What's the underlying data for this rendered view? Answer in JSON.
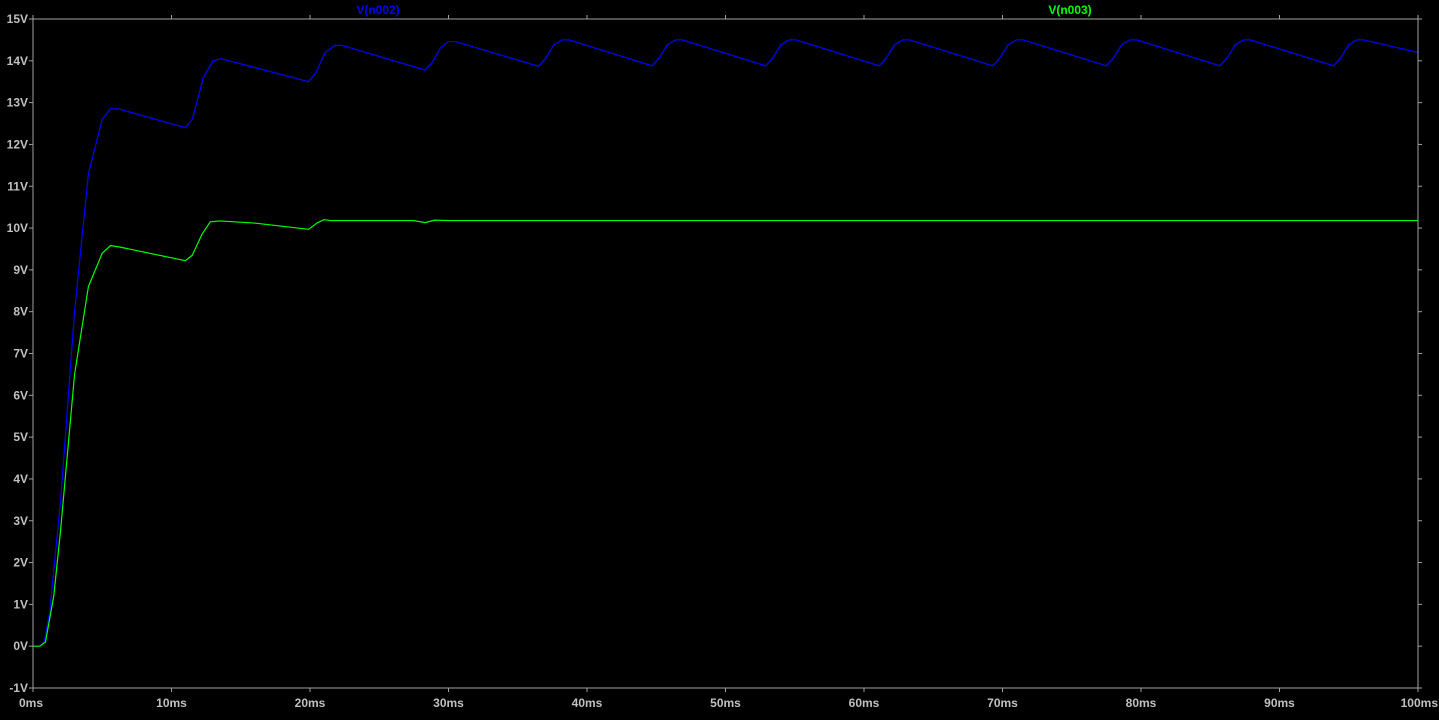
{
  "colors": {
    "background": "#000000",
    "frame": "#a0a0a0",
    "tick_text": "#c0c0c0"
  },
  "chart_data": {
    "type": "line",
    "title": "",
    "xlabel": "",
    "ylabel": "",
    "x_unit": "ms",
    "y_unit": "V",
    "xlim": [
      0,
      100
    ],
    "ylim": [
      -1,
      15
    ],
    "grid": false,
    "x_ticks": [
      0,
      10,
      20,
      30,
      40,
      50,
      60,
      70,
      80,
      90,
      100
    ],
    "y_ticks": [
      -1,
      0,
      1,
      2,
      3,
      4,
      5,
      6,
      7,
      8,
      9,
      10,
      11,
      12,
      13,
      14,
      15
    ],
    "x_tick_labels": [
      "0ms",
      "10ms",
      "20ms",
      "30ms",
      "40ms",
      "50ms",
      "60ms",
      "70ms",
      "80ms",
      "90ms",
      "100ms"
    ],
    "y_tick_labels": [
      "-1V",
      "0V",
      "1V",
      "2V",
      "3V",
      "4V",
      "5V",
      "6V",
      "7V",
      "8V",
      "9V",
      "10V",
      "11V",
      "12V",
      "13V",
      "14V",
      "15V"
    ],
    "legend_placement": "top",
    "series": [
      {
        "name": "V(n002)",
        "color": "#0000ff",
        "points": [
          [
            0,
            0
          ],
          [
            0.5,
            0
          ],
          [
            0.8,
            0.1
          ],
          [
            1.2,
            0.8
          ],
          [
            2,
            3.5
          ],
          [
            3,
            8
          ],
          [
            4,
            11.3
          ],
          [
            5,
            12.6
          ],
          [
            5.6,
            12.85
          ],
          [
            6.2,
            12.85
          ],
          [
            11,
            12.4
          ],
          [
            11.5,
            12.6
          ],
          [
            12.3,
            13.6
          ],
          [
            13,
            14.0
          ],
          [
            13.6,
            14.05
          ],
          [
            19.9,
            13.5
          ],
          [
            20.4,
            13.7
          ],
          [
            21.1,
            14.2
          ],
          [
            21.8,
            14.37
          ],
          [
            22.3,
            14.37
          ],
          [
            28.3,
            13.78
          ],
          [
            28.8,
            13.95
          ],
          [
            29.4,
            14.3
          ],
          [
            30.0,
            14.46
          ],
          [
            30.5,
            14.46
          ],
          [
            36.5,
            13.87
          ],
          [
            37.0,
            14.05
          ],
          [
            37.6,
            14.38
          ],
          [
            38.2,
            14.5
          ],
          [
            38.7,
            14.5
          ],
          [
            44.7,
            13.88
          ],
          [
            45.2,
            14.06
          ],
          [
            45.8,
            14.38
          ],
          [
            46.4,
            14.5
          ],
          [
            46.9,
            14.5
          ],
          [
            52.9,
            13.88
          ],
          [
            53.4,
            14.06
          ],
          [
            54.0,
            14.38
          ],
          [
            54.6,
            14.5
          ],
          [
            55.1,
            14.5
          ],
          [
            61.1,
            13.88
          ],
          [
            61.6,
            14.06
          ],
          [
            62.2,
            14.38
          ],
          [
            62.8,
            14.5
          ],
          [
            63.3,
            14.5
          ],
          [
            69.3,
            13.88
          ],
          [
            69.8,
            14.06
          ],
          [
            70.4,
            14.38
          ],
          [
            71.0,
            14.5
          ],
          [
            71.5,
            14.5
          ],
          [
            77.5,
            13.88
          ],
          [
            78.0,
            14.06
          ],
          [
            78.6,
            14.38
          ],
          [
            79.2,
            14.5
          ],
          [
            79.7,
            14.5
          ],
          [
            85.7,
            13.88
          ],
          [
            86.2,
            14.06
          ],
          [
            86.8,
            14.38
          ],
          [
            87.4,
            14.5
          ],
          [
            87.9,
            14.5
          ],
          [
            93.9,
            13.88
          ],
          [
            94.4,
            14.06
          ],
          [
            95.0,
            14.38
          ],
          [
            95.6,
            14.5
          ],
          [
            96.1,
            14.5
          ],
          [
            100,
            14.2
          ]
        ]
      },
      {
        "name": "V(n003)",
        "color": "#00ff00",
        "points": [
          [
            0,
            0
          ],
          [
            0.5,
            0
          ],
          [
            0.9,
            0.1
          ],
          [
            1.5,
            1.2
          ],
          [
            2,
            2.8
          ],
          [
            3,
            6.5
          ],
          [
            4,
            8.6
          ],
          [
            5,
            9.4
          ],
          [
            5.6,
            9.58
          ],
          [
            6.2,
            9.55
          ],
          [
            11,
            9.22
          ],
          [
            11.5,
            9.35
          ],
          [
            12.2,
            9.85
          ],
          [
            12.8,
            10.15
          ],
          [
            13.5,
            10.17
          ],
          [
            16,
            10.12
          ],
          [
            19.9,
            9.97
          ],
          [
            20.5,
            10.12
          ],
          [
            21,
            10.2
          ],
          [
            21.5,
            10.18
          ],
          [
            27.5,
            10.18
          ],
          [
            28.3,
            10.13
          ],
          [
            29,
            10.19
          ],
          [
            30,
            10.18
          ],
          [
            100,
            10.18
          ]
        ]
      }
    ]
  }
}
